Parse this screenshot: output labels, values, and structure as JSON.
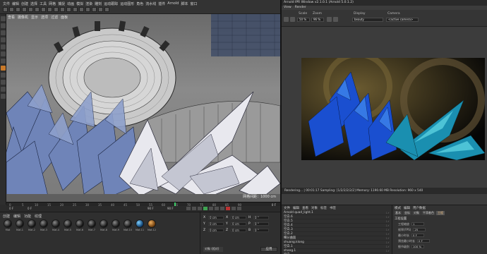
{
  "topbar": {
    "menu": [
      "文件",
      "编辑",
      "创建",
      "选择",
      "工具",
      "网格",
      "捕捉",
      "动画",
      "模拟",
      "渲染",
      "雕刻",
      "运动跟踪",
      "运动图形",
      "角色",
      "流水线",
      "插件",
      "Arnold",
      "脚本",
      "窗口"
    ]
  },
  "viewport": {
    "menu": [
      "查看",
      "摄像机",
      "显示",
      "选项",
      "过滤",
      "面板"
    ],
    "scale_readout": "网格间距：1000 cm"
  },
  "timeline": {
    "ticks": [
      "0",
      "5",
      "10",
      "15",
      "20",
      "25",
      "30",
      "35",
      "40",
      "45",
      "50",
      "55",
      "60",
      "65",
      "70",
      "75",
      "80",
      "85",
      "90"
    ],
    "frame_readout": "0 F",
    "start": "0 F",
    "current": "0 F",
    "end": "90 F",
    "end_max": "90 F"
  },
  "materials": {
    "menu": [
      "创建",
      "编辑",
      "功能",
      "纹理"
    ],
    "items": [
      {
        "name": "Mat",
        "style": "dark"
      },
      {
        "name": "Mat.1",
        "style": "dark"
      },
      {
        "name": "Mat.2",
        "style": "dark"
      },
      {
        "name": "Mat.3",
        "style": "dark"
      },
      {
        "name": "Mat.4",
        "style": "dark"
      },
      {
        "name": "Mat.5",
        "style": "dark"
      },
      {
        "name": "Mat.6",
        "style": "dark"
      },
      {
        "name": "Mat.7",
        "style": "dark"
      },
      {
        "name": "Mat.8",
        "style": "dark"
      },
      {
        "name": "Mat.9",
        "style": "dark"
      },
      {
        "name": "Mat.10",
        "style": "dark"
      },
      {
        "name": "Mat.11",
        "style": "blue"
      },
      {
        "name": "Mat.12",
        "style": "orange"
      }
    ]
  },
  "coords": {
    "rows": [
      {
        "axis": "X",
        "pos": "0 cm",
        "axis2": "X",
        "size": "0 cm",
        "axis3": "H",
        "rot": "0 °"
      },
      {
        "axis": "Y",
        "pos": "0 cm",
        "axis2": "Y",
        "size": "0 cm",
        "axis3": "P",
        "rot": "0 °"
      },
      {
        "axis": "Z",
        "pos": "0 cm",
        "axis2": "Z",
        "size": "0 cm",
        "axis3": "B",
        "rot": "0 °"
      }
    ],
    "mode": "对象 (相对)",
    "apply": "应用"
  },
  "ipr": {
    "title": "Arnold IPR Window v2.1.0.1 (Arnold 5.0.1.2)",
    "menu": [
      "View",
      "Render"
    ],
    "labels": {
      "scale": "Scale",
      "zoom": "Zoom",
      "display": "Display",
      "camera": "Camera"
    },
    "values": {
      "scale": "50 %",
      "zoom": "96 %",
      "display": "beauty",
      "camera": "<active camera>"
    },
    "status": "Rendering...   |   00:01:17   Sampling: [1/2/2/2/2/2]   Memory: 1190.60 MB   Resolution: 960 x 540"
  },
  "objects": {
    "menu": [
      "文件",
      "编辑",
      "查看",
      "对象",
      "标签",
      "书签"
    ],
    "items": [
      "Arnold quad_light.1",
      "空白.6",
      "空白.5",
      "空白.4",
      "空白.3",
      "空白.2",
      "细分曲面",
      "shuang.klong",
      "空白.1",
      "shang.1",
      "空白",
      "立方体.1",
      "立方体"
    ]
  },
  "attrs": {
    "menu": [
      "模式",
      "编辑",
      "用户数据"
    ],
    "tabs": [
      "基本",
      "坐标",
      "对象",
      "平滑着色",
      "工程"
    ],
    "section": "工程设置",
    "rows": [
      {
        "label": "工程缩放",
        "value": "1"
      },
      {
        "label": "帧率(FPS)",
        "value": "25"
      },
      {
        "label": "最小时长",
        "value": "0 F"
      },
      {
        "label": "预览最小时长",
        "value": "0 F"
      },
      {
        "label": "细节级别",
        "value": "100 %"
      }
    ]
  }
}
